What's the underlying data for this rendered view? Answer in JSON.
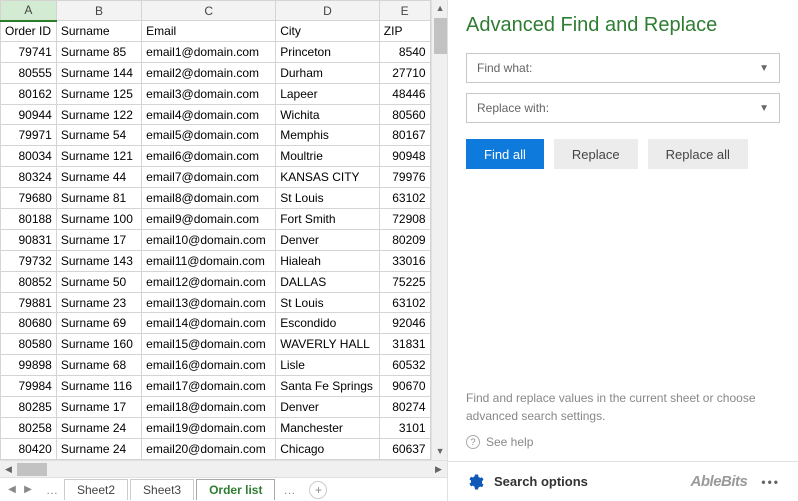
{
  "columns": {
    "A": "A",
    "B": "B",
    "C": "C",
    "D": "D",
    "E": "E"
  },
  "headers": {
    "orderId": "Order ID",
    "surname": "Surname",
    "email": "Email",
    "city": "City",
    "zip": "ZIP"
  },
  "rows": [
    {
      "id": "79741",
      "surname": "Surname 85",
      "email": "email1@domain.com",
      "city": "Princeton",
      "zip": "8540"
    },
    {
      "id": "80555",
      "surname": "Surname 144",
      "email": "email2@domain.com",
      "city": "Durham",
      "zip": "27710"
    },
    {
      "id": "80162",
      "surname": "Surname 125",
      "email": "email3@domain.com",
      "city": "Lapeer",
      "zip": "48446"
    },
    {
      "id": "90944",
      "surname": "Surname 122",
      "email": "email4@domain.com",
      "city": "Wichita",
      "zip": "80560"
    },
    {
      "id": "79971",
      "surname": "Surname 54",
      "email": "email5@domain.com",
      "city": "Memphis",
      "zip": "80167"
    },
    {
      "id": "80034",
      "surname": "Surname 121",
      "email": "email6@domain.com",
      "city": "Moultrie",
      "zip": "90948"
    },
    {
      "id": "80324",
      "surname": "Surname 44",
      "email": "email7@domain.com",
      "city": "KANSAS CITY",
      "zip": "79976"
    },
    {
      "id": "79680",
      "surname": "Surname 81",
      "email": "email8@domain.com",
      "city": "St Louis",
      "zip": "63102"
    },
    {
      "id": "80188",
      "surname": "Surname 100",
      "email": "email9@domain.com",
      "city": "Fort Smith",
      "zip": "72908"
    },
    {
      "id": "90831",
      "surname": "Surname 17",
      "email": "email10@domain.com",
      "city": "Denver",
      "zip": "80209"
    },
    {
      "id": "79732",
      "surname": "Surname 143",
      "email": "email11@domain.com",
      "city": "Hialeah",
      "zip": "33016"
    },
    {
      "id": "80852",
      "surname": "Surname 50",
      "email": "email12@domain.com",
      "city": "DALLAS",
      "zip": "75225"
    },
    {
      "id": "79881",
      "surname": "Surname 23",
      "email": "email13@domain.com",
      "city": "St Louis",
      "zip": "63102"
    },
    {
      "id": "80680",
      "surname": "Surname 69",
      "email": "email14@domain.com",
      "city": "Escondido",
      "zip": "92046"
    },
    {
      "id": "80580",
      "surname": "Surname 160",
      "email": "email15@domain.com",
      "city": "WAVERLY HALL",
      "zip": "31831"
    },
    {
      "id": "99898",
      "surname": "Surname 68",
      "email": "email16@domain.com",
      "city": "Lisle",
      "zip": "60532"
    },
    {
      "id": "79984",
      "surname": "Surname 116",
      "email": "email17@domain.com",
      "city": "Santa Fe Springs",
      "zip": "90670"
    },
    {
      "id": "80285",
      "surname": "Surname 17",
      "email": "email18@domain.com",
      "city": "Denver",
      "zip": "80274"
    },
    {
      "id": "80258",
      "surname": "Surname 24",
      "email": "email19@domain.com",
      "city": "Manchester",
      "zip": "3101"
    },
    {
      "id": "80420",
      "surname": "Surname 24",
      "email": "email20@domain.com",
      "city": "Chicago",
      "zip": "60637"
    }
  ],
  "tabs": {
    "sheet2": "Sheet2",
    "sheet3": "Sheet3",
    "orderList": "Order list"
  },
  "panel": {
    "title": "Advanced Find and Replace",
    "findWhat": "Find what:",
    "replaceWith": "Replace with:",
    "findAll": "Find all",
    "replace": "Replace",
    "replaceAll": "Replace all",
    "hint": "Find and replace values in the current sheet or choose advanced search settings.",
    "seeHelp": "See help"
  },
  "footer": {
    "searchOptions": "Search options",
    "brand": "AbleBits"
  }
}
